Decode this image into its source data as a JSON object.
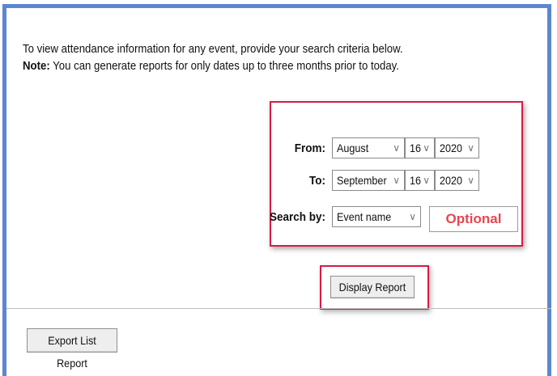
{
  "intro": {
    "line1": "To view attendance information for any event, provide your search criteria below.",
    "note_label": "Note:",
    "note_text": " You can generate reports for only dates up to three months prior to today."
  },
  "criteria": {
    "from": {
      "label": "From:",
      "month": "August",
      "day": "16",
      "year": "2020"
    },
    "to": {
      "label": "To:",
      "month": "September",
      "day": "16",
      "year": "2020"
    },
    "search_by": {
      "label": "Search by:",
      "value": "Event name",
      "optional_label": "Optional"
    }
  },
  "buttons": {
    "display_report": "Display Report",
    "export_list_report": "Export List Report"
  },
  "colors": {
    "frame_border": "#5b87d0",
    "highlight_border": "#d81b45",
    "optional_text": "#e8454f"
  },
  "icons": {
    "dropdown": "chevron-down-icon"
  }
}
